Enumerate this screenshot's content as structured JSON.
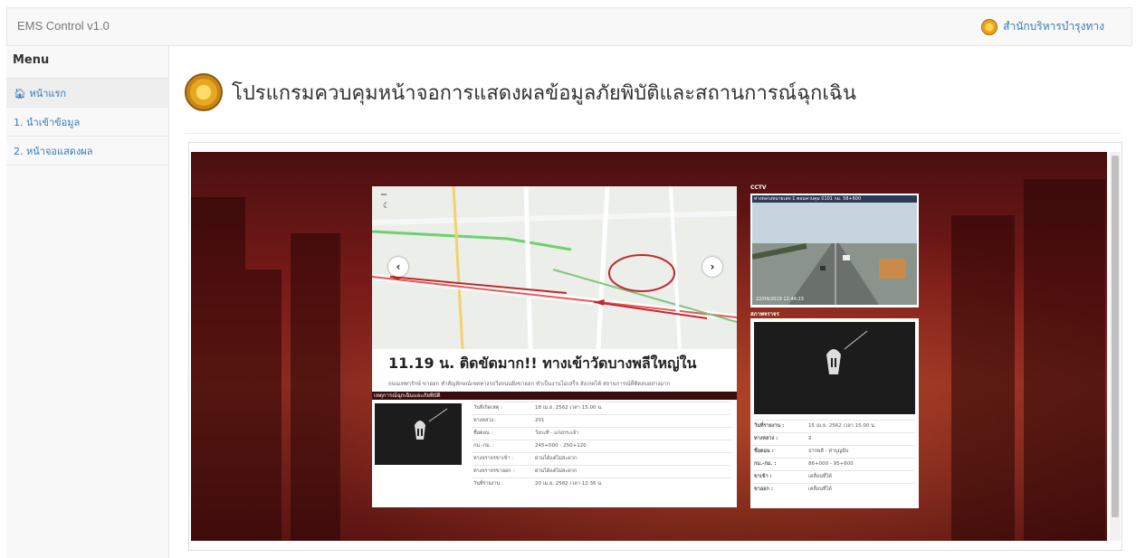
{
  "app": {
    "brand": "EMS Control v1.0",
    "org": "สำนักบริหารบำรุงทาง"
  },
  "sidebar": {
    "title": "Menu",
    "items": [
      {
        "icon": "home-icon",
        "label": "หน้าแรก"
      },
      {
        "label": "1. นำเข้าข้อมูล"
      },
      {
        "label": "2. หน้าจอแสดงผล"
      }
    ]
  },
  "page": {
    "title": "โปรแกรมควบคุมหน้าจอการแสดงผลข้อมูลภัยพิบัติและสถานการณ์ฉุกเฉิน"
  },
  "display": {
    "headline": "11.19 น. ติดขัดมาก!! ทางเข้าวัดบางพลีใหญ่ใน",
    "subline": "ถนนเทพารักษ์ ขาออก ทำสัญลักษณ์เขตทางรถวิ่งถนนฝั่งขาออก ทำเป็นงานไม่เสร็จ สังเกตได้ สถานการณ์ที่ติดลบอย่างมาก",
    "incident_label": "เหตุการณ์ฉุกเฉินและภัยพิบัติ",
    "incident_rows": [
      {
        "k": "วันที่เกิดเหตุ :",
        "v": "18 เม.ย. 2562 เวลา 15:00 น."
      },
      {
        "k": "ทางหลวง :",
        "v": "201"
      },
      {
        "k": "ชื่อตอน :",
        "v": "วังกะทิ - แก่งกระเจ้า"
      },
      {
        "k": "กม.-กม. :",
        "v": "245+000 - 250+120"
      },
      {
        "k": "ทางจราจรขาเข้า :",
        "v": "ผ่านได้แต่ไม่สะดวก"
      },
      {
        "k": "ทางจราจรขาออก :",
        "v": "ผ่านได้แต่ไม่สะดวก"
      },
      {
        "k": "วันที่รายงาน :",
        "v": "20 เม.ย. 2562 เวลา 12:36 น."
      }
    ],
    "cctv_label": "CCTV",
    "cctv_caption": "ทางหลวงหมายเลข 1 ตอนควบคุม 0101 กม. 58+600",
    "cctv_timestamp": "22/04/2019 12:44:23",
    "traffic_label": "สภาพจราจร",
    "traffic_rows": [
      {
        "k": "วันที่รายงาน :",
        "v": "15 เม.ย. 2562 เวลา 15.00 น."
      },
      {
        "k": "ทางหลวง :",
        "v": "2"
      },
      {
        "k": "ชื่อตอน :",
        "v": "ปากพลี - ท่าบุญมีบ"
      },
      {
        "k": "กม.-กม. :",
        "v": "86+000 - 95+600"
      },
      {
        "k": "ขาเข้า :",
        "v": "เคลื่อนที่ได้"
      },
      {
        "k": "ขาออก :",
        "v": "เคลื่อนที่ได้"
      }
    ]
  },
  "colors": {
    "link": "#337ab7",
    "banner_dark": "#4a0f10",
    "banner_red": "#8b2a1f"
  }
}
